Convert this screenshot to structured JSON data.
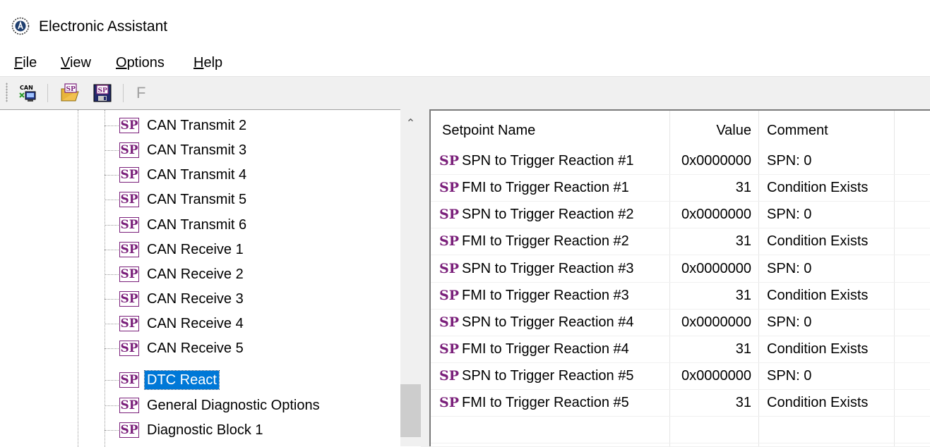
{
  "window": {
    "title": "Electronic Assistant",
    "icon": "app-logo-icon"
  },
  "menu": [
    {
      "label": "File",
      "accel": "F",
      "rest": "ile"
    },
    {
      "label": "View",
      "accel": "V",
      "rest": "iew"
    },
    {
      "label": "Options",
      "accel": "O",
      "rest": "ptions"
    },
    {
      "label": "Help",
      "accel": "H",
      "rest": "elp"
    }
  ],
  "toolbar": {
    "buttons": [
      "can-connect-icon",
      "open-setpoint-file-icon",
      "save-setpoint-file-icon"
    ],
    "flash_label": "F"
  },
  "tree": {
    "sp_badge": "SP",
    "items": [
      {
        "label": "CAN Transmit 2",
        "selected": false
      },
      {
        "label": "CAN Transmit 3",
        "selected": false
      },
      {
        "label": "CAN Transmit 4",
        "selected": false
      },
      {
        "label": "CAN Transmit 5",
        "selected": false
      },
      {
        "label": "CAN Transmit 6",
        "selected": false
      },
      {
        "label": "CAN Receive 1",
        "selected": false
      },
      {
        "label": "CAN Receive 2",
        "selected": false
      },
      {
        "label": "CAN Receive 3",
        "selected": false
      },
      {
        "label": "CAN Receive 4",
        "selected": false
      },
      {
        "label": "CAN Receive 5",
        "selected": false
      },
      {
        "label": "DTC React",
        "selected": true
      },
      {
        "label": "General Diagnostic Options",
        "selected": false
      },
      {
        "label": "Diagnostic Block 1",
        "selected": false
      }
    ]
  },
  "list": {
    "columns": {
      "name": "Setpoint Name",
      "value": "Value",
      "comment": "Comment"
    },
    "sp_badge": "SP",
    "rows": [
      {
        "name": "SPN to Trigger Reaction #1",
        "value": "0x0000000",
        "comment": "SPN: 0"
      },
      {
        "name": "FMI to Trigger Reaction #1",
        "value": "31",
        "comment": "Condition Exists"
      },
      {
        "name": "SPN to Trigger Reaction #2",
        "value": "0x0000000",
        "comment": "SPN: 0"
      },
      {
        "name": "FMI to Trigger Reaction #2",
        "value": "31",
        "comment": "Condition Exists"
      },
      {
        "name": "SPN to Trigger Reaction #3",
        "value": "0x0000000",
        "comment": "SPN: 0"
      },
      {
        "name": "FMI to Trigger Reaction #3",
        "value": "31",
        "comment": "Condition Exists"
      },
      {
        "name": "SPN to Trigger Reaction #4",
        "value": "0x0000000",
        "comment": "SPN: 0"
      },
      {
        "name": "FMI to Trigger Reaction #4",
        "value": "31",
        "comment": "Condition Exists"
      },
      {
        "name": "SPN to Trigger Reaction #5",
        "value": "0x0000000",
        "comment": "SPN: 0"
      },
      {
        "name": "FMI to Trigger Reaction #5",
        "value": "31",
        "comment": "Condition Exists"
      }
    ]
  },
  "colors": {
    "sp_badge": "#7a1f7a",
    "selection": "#0078d7"
  }
}
